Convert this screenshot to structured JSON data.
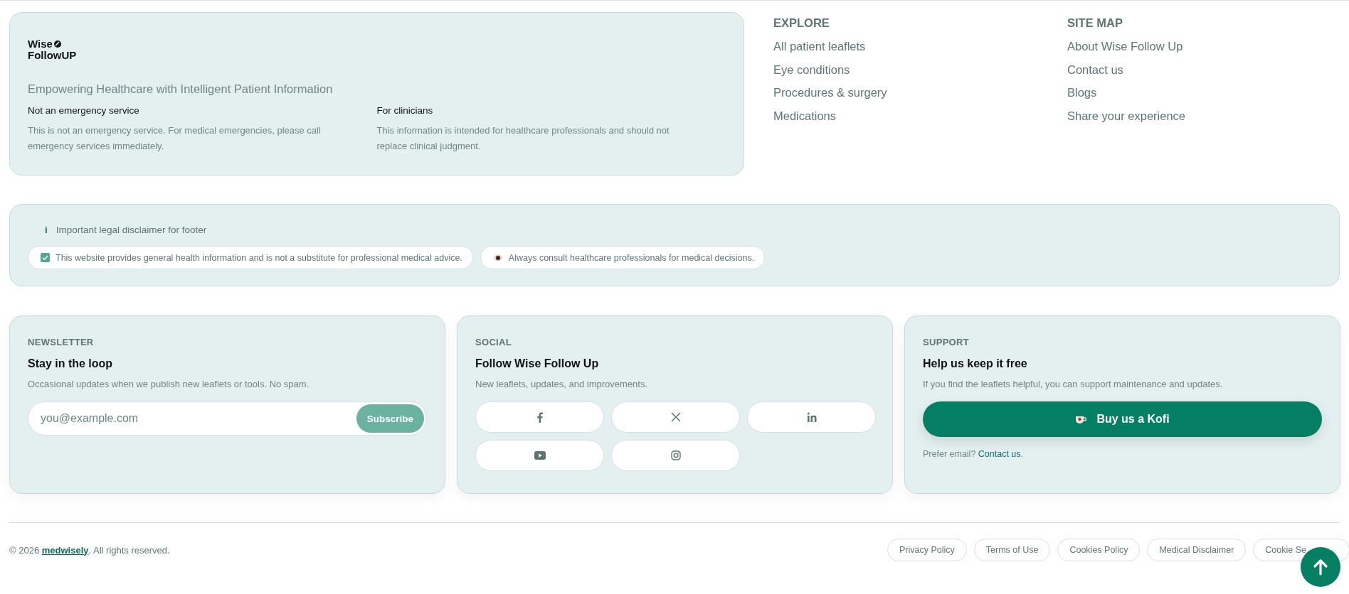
{
  "brand": {
    "logo_line_1": "Wise",
    "logo_line_2": "FollowUP",
    "tagline": "Empowering Healthcare with Intelligent Patient Information",
    "notes": [
      {
        "title": "Not an emergency service",
        "text": "This is not an emergency service. For medical emergencies, please call emergency services immediately."
      },
      {
        "title": "For clinicians",
        "text": "This information is intended for healthcare professionals and should not replace clinical judgment."
      }
    ]
  },
  "link_columns": [
    {
      "heading": "EXPLORE",
      "links": [
        "All patient leaflets",
        "Eye conditions",
        "Procedures & surgery",
        "Medications"
      ]
    },
    {
      "heading": "SITE MAP",
      "links": [
        "About Wise Follow Up",
        "Contact us",
        "Blogs",
        "Share your experience"
      ]
    }
  ],
  "disclaimer": {
    "icon": "i",
    "title": "Important legal disclaimer for footer",
    "pills": [
      {
        "kind": "check",
        "text": "This website provides general health information and is not a substitute for professional medical advice."
      },
      {
        "kind": "eye",
        "text": "Always consult healthcare professionals for medical decisions."
      }
    ]
  },
  "newsletter": {
    "label": "NEWSLETTER",
    "title": "Stay in the loop",
    "text": "Occasional updates when we publish new leaflets or tools. No spam.",
    "placeholder": "you@example.com",
    "button": "Subscribe"
  },
  "social": {
    "label": "SOCIAL",
    "title": "Follow Wise Follow Up",
    "text": "New leaflets, updates, and improvements.",
    "buttons": [
      {
        "kind": "facebook"
      },
      {
        "kind": "x"
      },
      {
        "kind": "linkedin"
      },
      {
        "kind": "youtube"
      },
      {
        "kind": "instagram"
      }
    ]
  },
  "support": {
    "label": "SUPPORT",
    "title": "Help us keep it free",
    "text": "If you find the leaflets helpful, you can support maintenance and updates.",
    "button": "Buy us a Kofi",
    "email_prefix": "Prefer email?",
    "email_link": "Contact us",
    "email_suffix": "."
  },
  "footer": {
    "copyright_prefix": "© 2026",
    "brand_link": "medwisely",
    "copyright_suffix": ". All rights reserved.",
    "links": [
      "Privacy Policy",
      "Terms of Use",
      "Cookies Policy",
      "Medical Disclaimer",
      "Cookie Se"
    ]
  }
}
